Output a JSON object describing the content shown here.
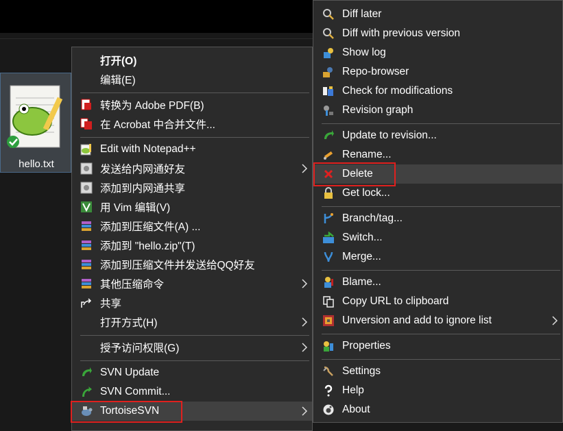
{
  "file": {
    "name": "hello.txt",
    "icon": "notepad-plus-plus-file-icon"
  },
  "main_menu": {
    "open": "打开(O)",
    "edit": "编辑(E)",
    "convert_pdf": "转换为 Adobe PDF(B)",
    "acrobat_merge": "在 Acrobat 中合并文件...",
    "notepadpp": "Edit with Notepad++",
    "send_intranet": "发送给内网通好友",
    "add_intranet_share": "添加到内网通共享",
    "vim_edit": "用 Vim 编辑(V)",
    "add_archive": "添加到压缩文件(A) ...",
    "add_hello_zip": "添加到 \"hello.zip\"(T)",
    "add_archive_qq": "添加到压缩文件并发送给QQ好友",
    "other_compress": "其他压缩命令",
    "share": "共享",
    "open_with": "打开方式(H)",
    "grant_access": "授予访问权限(G)",
    "svn_update": "SVN Update",
    "svn_commit": "SVN Commit...",
    "tortoisesvn": "TortoiseSVN"
  },
  "svn_menu": {
    "diff_later": "Diff later",
    "diff_prev": "Diff with previous version",
    "show_log": "Show log",
    "repo_browser": "Repo-browser",
    "check_mods": "Check for modifications",
    "revision_graph": "Revision graph",
    "update_rev": "Update to revision...",
    "rename": "Rename...",
    "delete": "Delete",
    "get_lock": "Get lock...",
    "branch_tag": "Branch/tag...",
    "switch": "Switch...",
    "merge": "Merge...",
    "blame": "Blame...",
    "copy_url": "Copy URL to clipboard",
    "unversion_ignore": "Unversion and add to ignore list",
    "properties": "Properties",
    "settings": "Settings",
    "help": "Help",
    "about": "About"
  },
  "colors": {
    "menu_bg": "#2b2b2b",
    "highlight": "#414141",
    "annotation_red": "#e0201e"
  }
}
